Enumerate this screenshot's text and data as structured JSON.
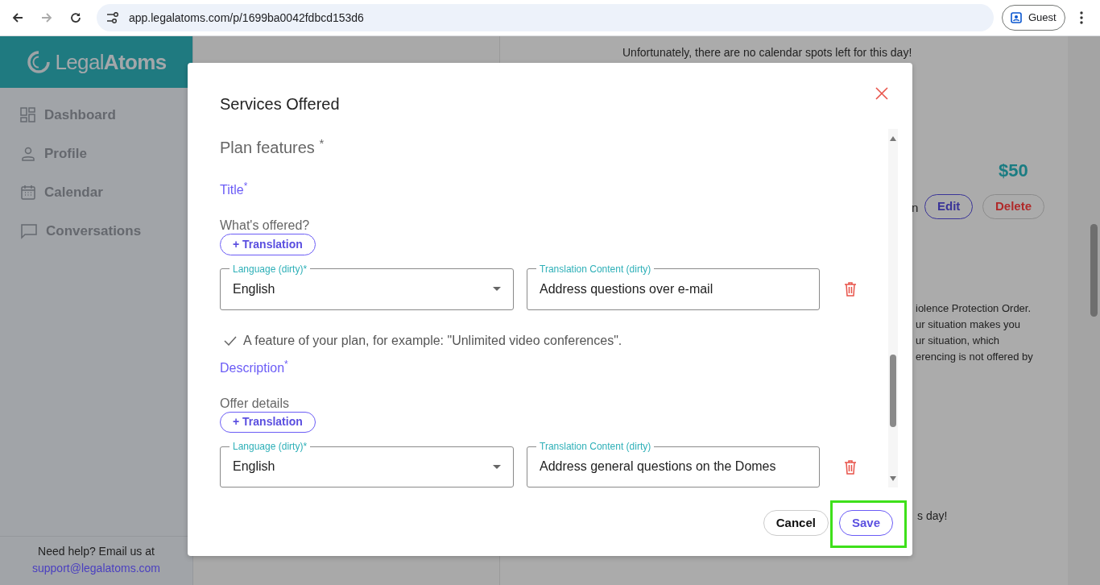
{
  "browser": {
    "url": "app.legalatoms.com/p/1699ba0042fdbcd153d6",
    "profile": "Guest"
  },
  "sidebar": {
    "logo_light": "Legal",
    "logo_bold": "Atoms",
    "items": [
      {
        "label": "Dashboard"
      },
      {
        "label": "Profile"
      },
      {
        "label": "Calendar"
      },
      {
        "label": "Conversations"
      }
    ],
    "help_text": "Need help? Email us at",
    "help_email": "support@legalatoms.com"
  },
  "background": {
    "notice": "Unfortunately, there are no calendar spots left for this day!",
    "price": "$50",
    "label_fragment": "n",
    "buttons": [
      "Edit",
      "Delete"
    ],
    "text_fragments": [
      "iolence Protection Order.",
      "ur situation makes you",
      "ur situation, which",
      "erencing is not offered by"
    ],
    "notice_fragment": "s day!"
  },
  "dialog": {
    "title": "Services Offered",
    "section_title": "Plan features $^{*}$",
    "fields": [
      {
        "label": "Title$^{*}$",
        "question": "What's offered?",
        "add_button": "+ Translation",
        "translations": [
          {
            "language_label": "Language (dirty)*",
            "language": "English",
            "content_label": "Translation Content (dirty)",
            "content": "Address questions over e-mail"
          }
        ],
        "hint": "A feature of your plan, for example: \"Unlimited video conferences\"."
      },
      {
        "label": "Description$^{*}$",
        "question": "Offer details",
        "add_button": "+ Translation",
        "translations": [
          {
            "language_label": "Language (dirty)*",
            "language": "English",
            "content_label": "Translation Content (dirty)",
            "content": "Address general questions on the Domes"
          }
        ]
      }
    ],
    "buttons": [
      {
        "label": "Cancel",
        "kind": "secondary",
        "highlighted": false
      },
      {
        "label": "Save",
        "kind": "primary",
        "highlighted": true
      }
    ]
  }
}
